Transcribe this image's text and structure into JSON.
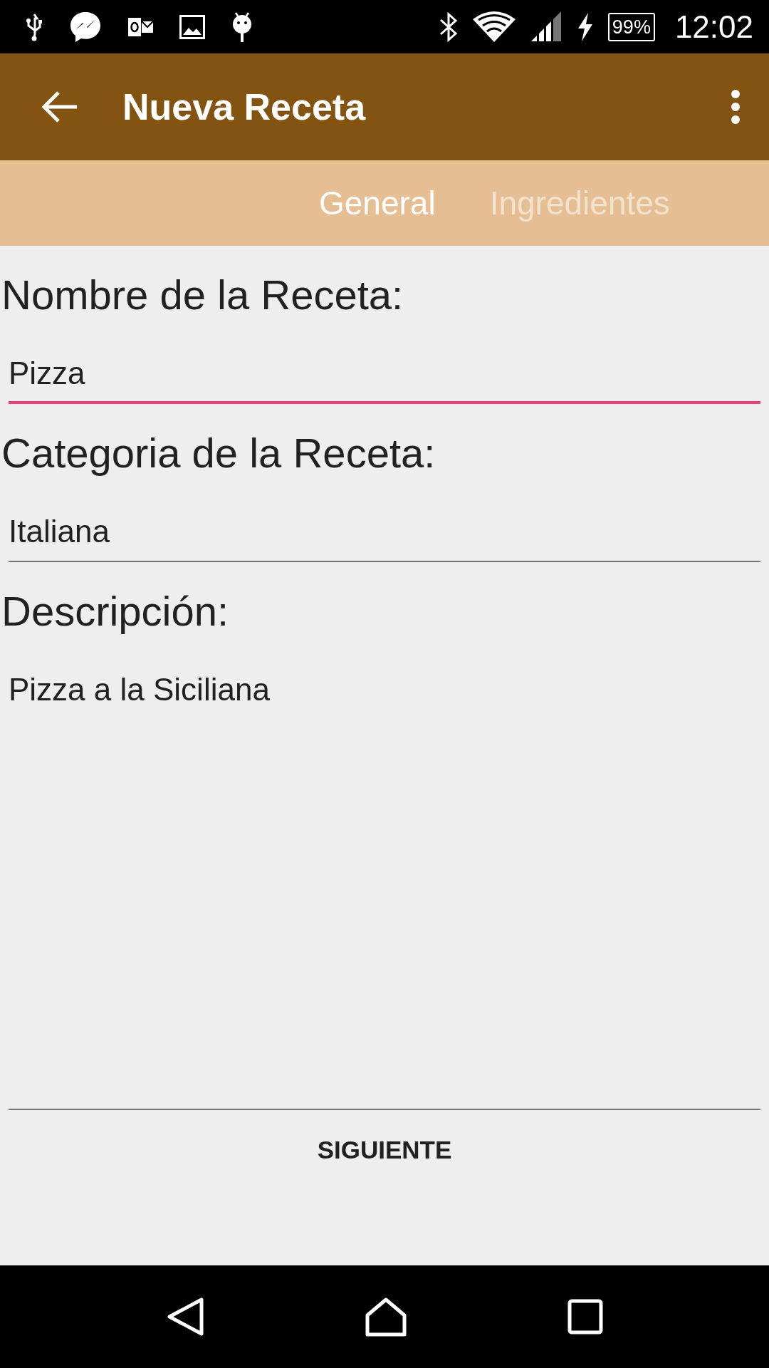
{
  "status_bar": {
    "battery": "99%",
    "time": "12:02"
  },
  "app_bar": {
    "title": "Nueva Receta"
  },
  "tabs": [
    {
      "label": "General",
      "selected": true
    },
    {
      "label": "Ingredientes",
      "selected": false
    }
  ],
  "form": {
    "fields": [
      {
        "label": "Nombre de la Receta:",
        "value": "Pizza",
        "focused": true,
        "kind": "line"
      },
      {
        "label": "Categoria de la Receta:",
        "value": "Italiana",
        "focused": false,
        "kind": "line"
      },
      {
        "label": "Descripción:",
        "value": "Pizza a la Siciliana",
        "focused": false,
        "kind": "multiline"
      }
    ],
    "button": "SIGUIENTE"
  }
}
